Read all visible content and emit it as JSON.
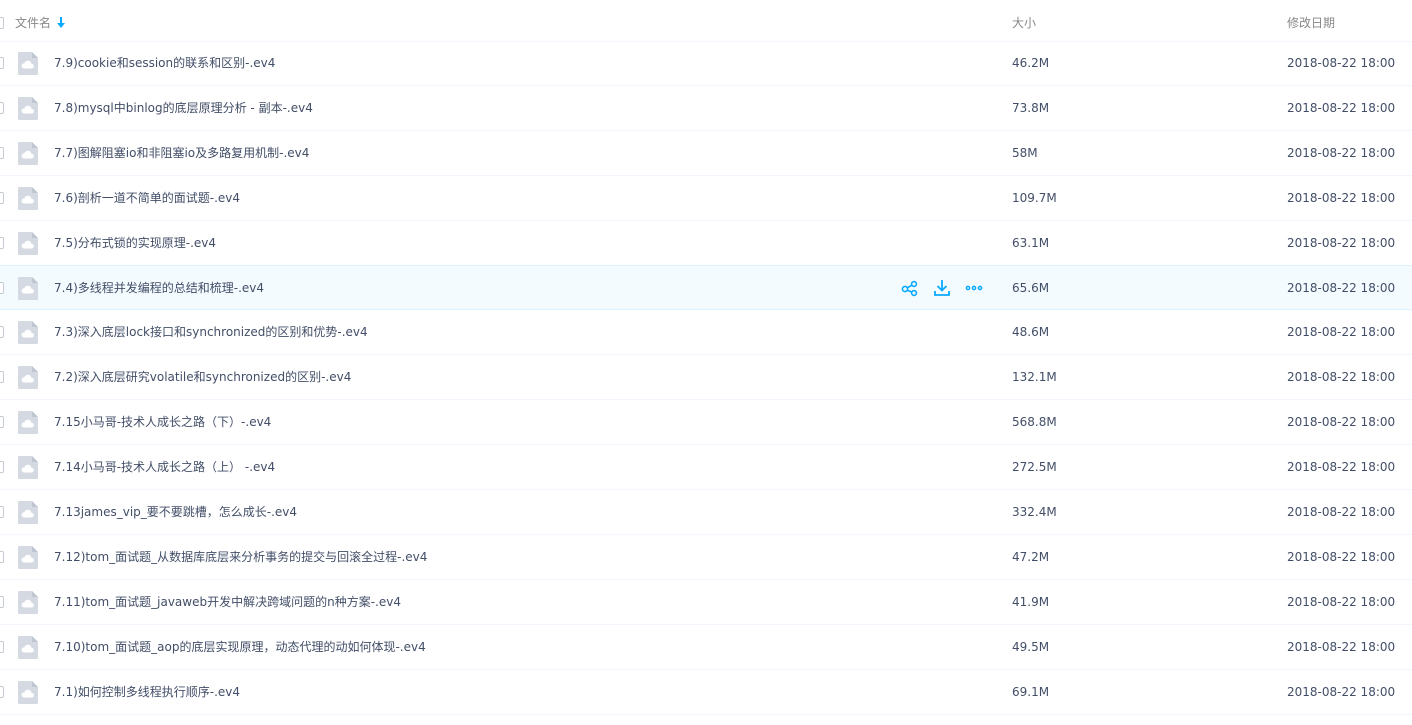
{
  "header": {
    "name_label": "文件名",
    "size_label": "大小",
    "date_label": "修改日期",
    "sort_icon": "arrow-down-icon"
  },
  "accent_color": "#09aaff",
  "hover_row_index": 5,
  "row_actions": [
    "share-icon",
    "download-icon",
    "more-icon"
  ],
  "files": [
    {
      "name": "7.9)cookie和session的联系和区别-.ev4",
      "size": "46.2M",
      "date": "2018-08-22 18:00"
    },
    {
      "name": "7.8)mysql中binlog的底层原理分析 - 副本-.ev4",
      "size": "73.8M",
      "date": "2018-08-22 18:00"
    },
    {
      "name": "7.7)图解阻塞io和非阻塞io及多路复用机制-.ev4",
      "size": "58M",
      "date": "2018-08-22 18:00"
    },
    {
      "name": "7.6)剖析一道不简单的面试题-.ev4",
      "size": "109.7M",
      "date": "2018-08-22 18:00"
    },
    {
      "name": "7.5)分布式锁的实现原理-.ev4",
      "size": "63.1M",
      "date": "2018-08-22 18:00"
    },
    {
      "name": "7.4)多线程并发编程的总结和梳理-.ev4",
      "size": "65.6M",
      "date": "2018-08-22 18:00"
    },
    {
      "name": "7.3)深入底层lock接口和synchronized的区别和优势-.ev4",
      "size": "48.6M",
      "date": "2018-08-22 18:00"
    },
    {
      "name": "7.2)深入底层研究volatile和synchronized的区别-.ev4",
      "size": "132.1M",
      "date": "2018-08-22 18:00"
    },
    {
      "name": "7.15小马哥-技术人成长之路（下）-.ev4",
      "size": "568.8M",
      "date": "2018-08-22 18:00"
    },
    {
      "name": "7.14小马哥-技术人成长之路（上） -.ev4",
      "size": "272.5M",
      "date": "2018-08-22 18:00"
    },
    {
      "name": "7.13james_vip_要不要跳槽，怎么成长-.ev4",
      "size": "332.4M",
      "date": "2018-08-22 18:00"
    },
    {
      "name": "7.12)tom_面试题_从数据库底层来分析事务的提交与回滚全过程-.ev4",
      "size": "47.2M",
      "date": "2018-08-22 18:00"
    },
    {
      "name": "7.11)tom_面试题_javaweb开发中解决跨域问题的n种方案-.ev4",
      "size": "41.9M",
      "date": "2018-08-22 18:00"
    },
    {
      "name": "7.10)tom_面试题_aop的底层实现原理，动态代理的动如何体现-.ev4",
      "size": "49.5M",
      "date": "2018-08-22 18:00"
    },
    {
      "name": "7.1)如何控制多线程执行顺序-.ev4",
      "size": "69.1M",
      "date": "2018-08-22 18:00"
    }
  ]
}
